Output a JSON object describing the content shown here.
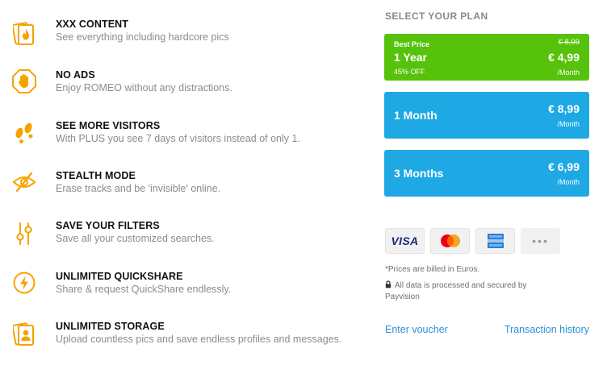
{
  "features": [
    {
      "title": "XXX CONTENT",
      "desc": "See everything including hardcore pics",
      "icon": "fire-card-icon"
    },
    {
      "title": "NO ADS",
      "desc": "Enjoy ROMEO without any distractions.",
      "icon": "stop-hand-icon"
    },
    {
      "title": "SEE MORE VISITORS",
      "desc": "With PLUS you see 7 days of visitors instead of only 1.",
      "icon": "footprints-icon"
    },
    {
      "title": "STEALTH MODE",
      "desc": "Erase tracks and be 'invisible' online.",
      "icon": "eye-slash-icon"
    },
    {
      "title": "SAVE YOUR FILTERS",
      "desc": "Save all your customized searches.",
      "icon": "filter-sliders-icon"
    },
    {
      "title": "UNLIMITED QUICKSHARE",
      "desc": "Share & request QuickShare endlessly.",
      "icon": "lightning-icon"
    },
    {
      "title": "UNLIMITED STORAGE",
      "desc": "Upload countless pics and save endless profiles and messages.",
      "icon": "profile-card-icon"
    }
  ],
  "plan": {
    "heading": "SELECT YOUR PLAN",
    "best": {
      "badge": "Best Price",
      "name": "1 Year",
      "discount": "45% OFF",
      "old_price": "€ 8,99",
      "price": "€ 4,99",
      "per": "/Month"
    },
    "one_month": {
      "name": "1 Month",
      "price": "€ 8,99",
      "per": "/Month"
    },
    "three_months": {
      "name": "3 Months",
      "price": "€ 6,99",
      "per": "/Month"
    }
  },
  "payment": {
    "visa_label": "VISA",
    "more_label": "•••"
  },
  "notes": {
    "prices": "*Prices are billed in Euros.",
    "secure": "All data is processed and secured by Payvision"
  },
  "links": {
    "voucher": "Enter voucher",
    "history": "Transaction history"
  },
  "colors": {
    "accent_orange": "#f5a300",
    "best_green": "#57c20b",
    "plan_blue": "#1ea8e4",
    "link_blue": "#2b90d9"
  }
}
